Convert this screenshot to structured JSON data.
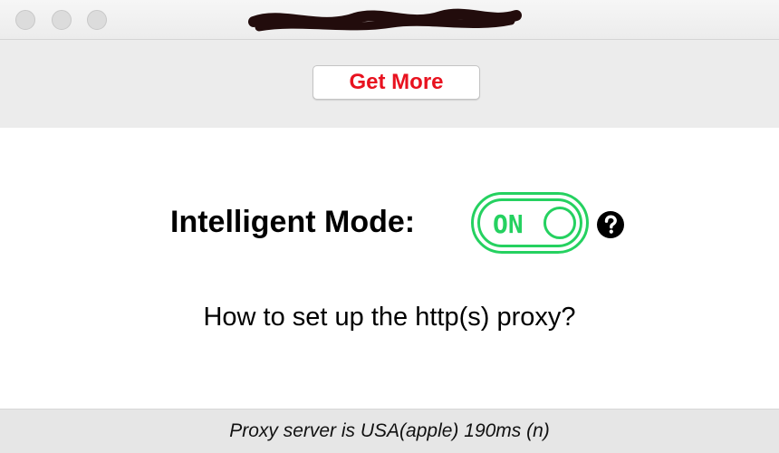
{
  "window": {
    "title_redacted": true,
    "traffic_lights": [
      "close",
      "minimize",
      "zoom"
    ]
  },
  "toolbar": {
    "get_more_label": "Get More",
    "get_more_color": "#e8121f"
  },
  "main": {
    "mode_label": "Intelligent Mode:",
    "toggle": {
      "state_label": "ON",
      "is_on": true,
      "accent_color": "#25d160"
    },
    "help_icon": "question-circle-icon",
    "help_link": "How to set up the http(s) proxy?"
  },
  "status": {
    "text": "Proxy server is USA(apple) 190ms (n)"
  }
}
